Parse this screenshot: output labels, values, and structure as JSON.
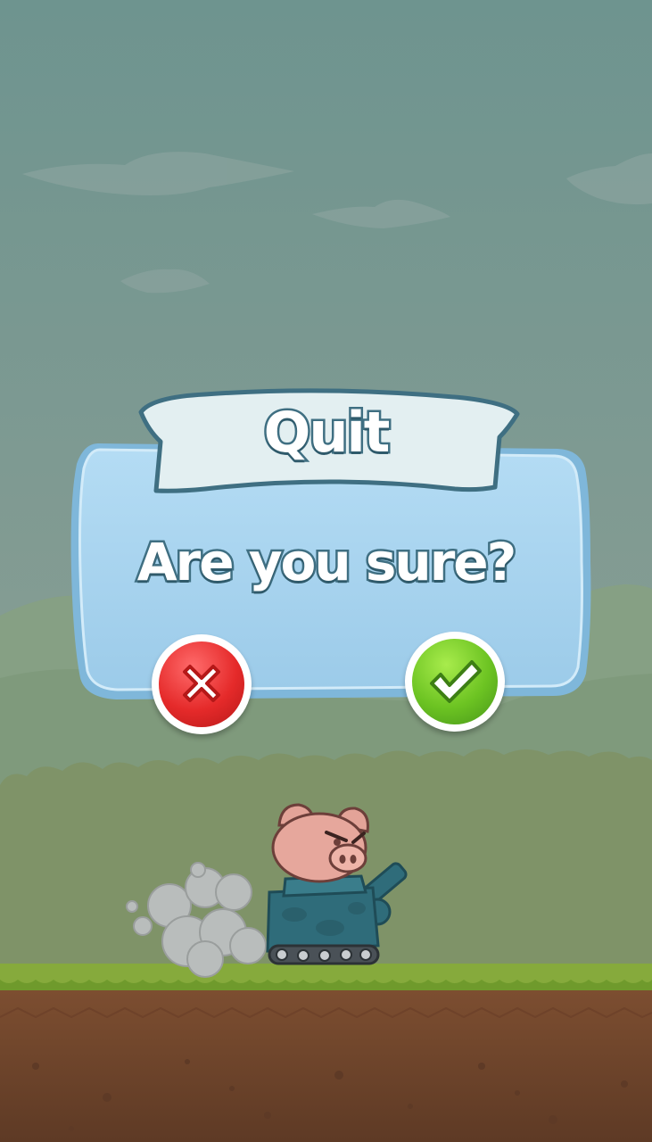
{
  "dialog": {
    "title": "Quit",
    "message": "Are you sure?",
    "cancel_icon": "close-icon",
    "confirm_icon": "check-icon"
  },
  "colors": {
    "sky_top": "#6f9690",
    "sky_bottom": "#8fa08a",
    "panel": "#a9d4ef",
    "panel_border": "#5f9fc4",
    "banner": "#e2eff0",
    "text_outline": "#3f6f82",
    "cancel": "#e52a2a",
    "confirm": "#6cc322",
    "grass": "#82a83a",
    "soil": "#7a4c30",
    "tank": "#2f6c7a",
    "pig": "#e3a398"
  }
}
